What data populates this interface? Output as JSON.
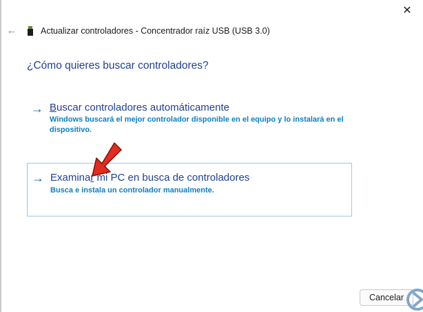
{
  "window": {
    "close_label": "✕",
    "back_label": "←",
    "title": "Actualizar controladores - Concentrador raíz USB (USB 3.0)",
    "title_icon": "usb-device-icon"
  },
  "main": {
    "question": "¿Cómo quieres buscar controladores?",
    "options": [
      {
        "arrow": "→",
        "title_first": "B",
        "title_rest": "uscar controladores automáticamente",
        "description": "Windows buscará el mejor controlador disponible en el equipo y lo instalará en el dispositivo."
      },
      {
        "arrow": "→",
        "title_before": "Examina",
        "title_underlined": "r",
        "title_after": " mi PC en busca de controladores",
        "description": "Busca e instala un controlador manualmente."
      }
    ]
  },
  "footer": {
    "cancel_label": "Cancelar"
  },
  "colors": {
    "link_blue": "#1f3f96",
    "desc_blue": "#0a7fc6",
    "selected_border": "#9ac7e8",
    "pointer_red": "#e52a1e"
  }
}
